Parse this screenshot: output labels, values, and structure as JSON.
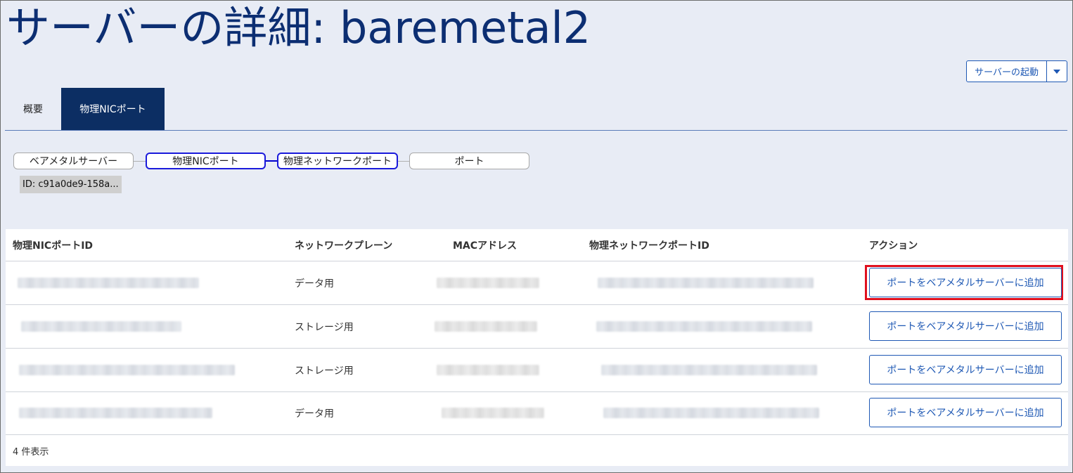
{
  "page": {
    "title": "サーバーの詳細: baremetal2"
  },
  "actions": {
    "start_button_label": "サーバーの起動",
    "dropdown_icon": "caret-down-icon"
  },
  "tabs": [
    {
      "label": "概要",
      "active": false
    },
    {
      "label": "物理NICポート",
      "active": true
    }
  ],
  "flow": {
    "nodes": [
      {
        "label": "ベアメタルサーバー",
        "selected": false
      },
      {
        "label": "物理NICポート",
        "selected": true
      },
      {
        "label": "物理ネットワークポート",
        "selected": true
      },
      {
        "label": "ポート",
        "selected": false
      }
    ],
    "id_label": "ID: c91a0de9-158a..."
  },
  "table": {
    "columns": [
      "物理NICポートID",
      "ネットワークプレーン",
      "MACアドレス",
      "物理ネットワークポートID",
      "アクション"
    ],
    "rows": [
      {
        "nic_port_id": "",
        "network_plane": "データ用",
        "mac_address": "",
        "network_port_id": "",
        "action_label": "ポートをベアメタルサーバーに追加",
        "highlighted": true
      },
      {
        "nic_port_id": "",
        "network_plane": "ストレージ用",
        "mac_address": "",
        "network_port_id": "",
        "action_label": "ポートをベアメタルサーバーに追加",
        "highlighted": false
      },
      {
        "nic_port_id": "",
        "network_plane": "ストレージ用",
        "mac_address": "",
        "network_port_id": "",
        "action_label": "ポートをベアメタルサーバーに追加",
        "highlighted": false
      },
      {
        "nic_port_id": "",
        "network_plane": "データ用",
        "mac_address": "",
        "network_port_id": "",
        "action_label": "ポートをベアメタルサーバーに追加",
        "highlighted": false
      }
    ],
    "footer": "4 件表示"
  },
  "colors": {
    "accent": "#1e58b4",
    "title": "#0c2e72",
    "active_tab": "#0c2e63",
    "highlight": "#e0101e"
  }
}
